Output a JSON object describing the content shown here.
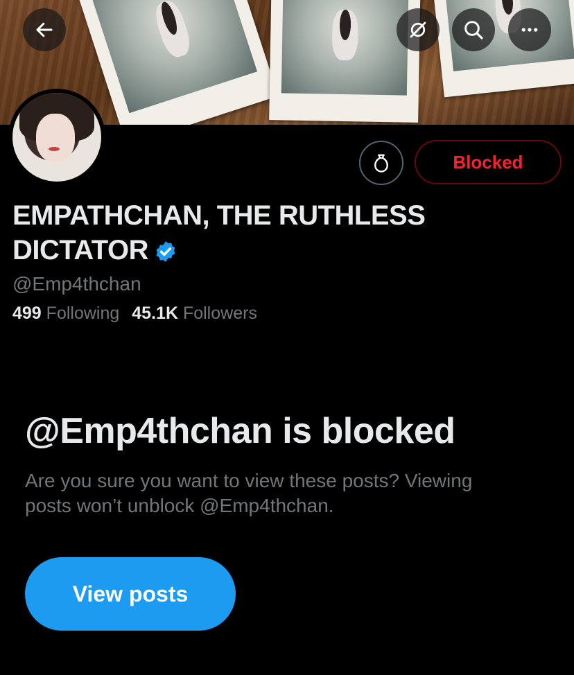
{
  "header": {
    "back_icon": "arrow-left-icon",
    "translate_icon": "translate-off-icon",
    "search_icon": "search-icon",
    "more_icon": "more-horizontal-icon"
  },
  "profile": {
    "display_name": "EMPATHCHAN, THE RUTHLESS DICTATOR",
    "verified_icon": "verified-badge-icon",
    "handle": "@Emp4thchan",
    "following_count": "499",
    "following_label": "Following",
    "followers_count": "45.1K",
    "followers_label": "Followers"
  },
  "actions": {
    "tip_icon": "money-bag-icon",
    "blocked_label": "Blocked"
  },
  "blocked_notice": {
    "title": "@Emp4thchan is blocked",
    "description": "Are you sure you want to view these posts? Viewing posts won’t unblock @Emp4thchan.",
    "view_button_label": "View posts"
  },
  "colors": {
    "background": "#000000",
    "accent_blue": "#1d9bf0",
    "blocked_red": "#f4212e",
    "secondary_text": "#71767b"
  }
}
